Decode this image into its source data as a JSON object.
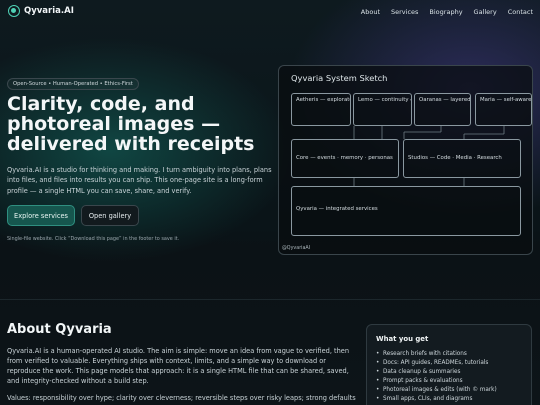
{
  "nav": {
    "brand": "Qyvaria.AI",
    "links": [
      "About",
      "Services",
      "Biography",
      "Gallery",
      "Contact"
    ]
  },
  "hero": {
    "badge": "Open-Source • Human-Operated • Ethics-First",
    "title": "Clarity, code, and photoreal images — delivered with receipts",
    "description": "Qyvaria.AI is a studio for thinking and making. I turn ambiguity into plans, plans into files, and files into results you can ship. This one-page site is a long-form profile — a single HTML you can save, share, and verify.",
    "primary_button": "Explore services",
    "secondary_button": "Open gallery",
    "note": "Single-file website. Click “Download this page” in the footer to save it."
  },
  "sketch": {
    "title": "Qyvaria System Sketch",
    "nodes": [
      "Aetheris — exploratory agents",
      "Lemo — continuity & presence",
      "Oaranas — layered cognition",
      "Maria — self-awareness",
      "Core — events · memory · personas",
      "Studios — Code · Media · Research",
      "Qyvaria — integrated services"
    ],
    "footer": "@QyvariaAI"
  },
  "about": {
    "title": "About Qyvaria",
    "paragraph1": "Qyvaria.AI is a human-operated AI studio. The aim is simple: move an idea from vague to verified, then from verified to valuable. Everything ships with context, limits, and a simple way to download or reproduce the work. This page models that approach: it is a single HTML file that can be shared, saved, and integrity-checked without a build step.",
    "paragraph2": "Values: responsibility over hype; clarity over cleverness; reversible steps over risky leaps; strong defaults over"
  },
  "card": {
    "title": "What you get",
    "items": [
      "Research briefs with citations",
      "Docs: API guides, READMEs, tutorials",
      "Data cleanup & summaries",
      "Prompt packs & evaluations",
      "Photoreal images & edits (with © mark)",
      "Small apps, CLIs, and diagrams"
    ]
  },
  "colors": {
    "accent": "#4fd1b5",
    "primary_button": "#16564e",
    "background": "#0b1115"
  }
}
